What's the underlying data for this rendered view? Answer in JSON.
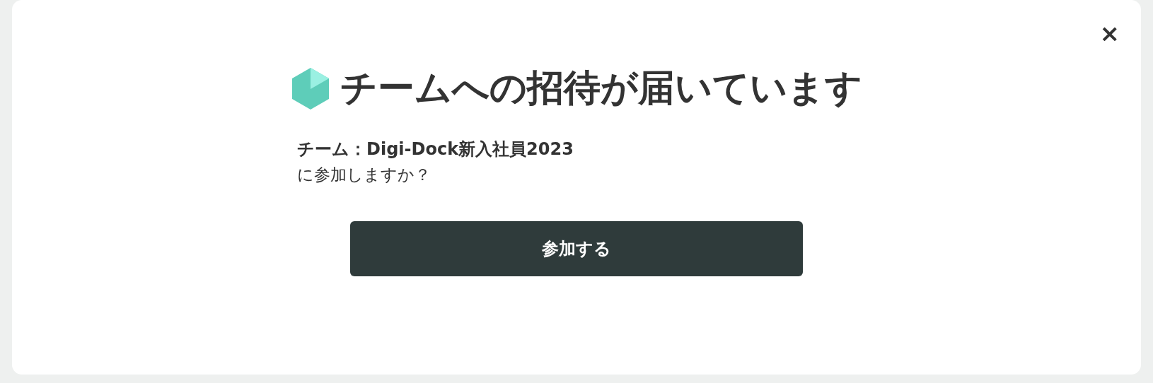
{
  "dialog": {
    "title": "チームへの招待が届いています",
    "close": "×",
    "team_line": "チーム：Digi-Dock新入社員2023",
    "question": "に参加しますか？",
    "join_button": "参加する"
  }
}
